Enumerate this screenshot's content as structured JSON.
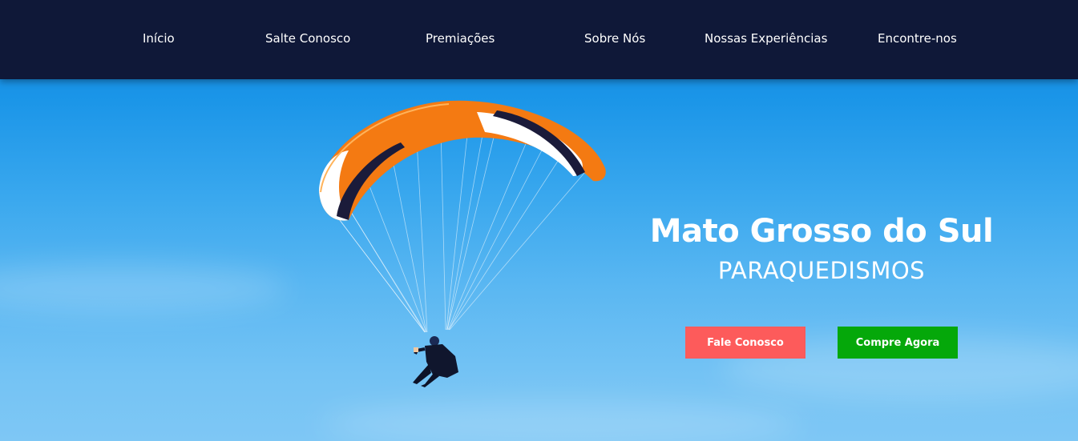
{
  "nav": {
    "items": [
      {
        "label": "Início"
      },
      {
        "label": "Salte Conosco"
      },
      {
        "label": "Premiações"
      },
      {
        "label": "Sobre Nós"
      },
      {
        "label": "Nossas Experiências"
      },
      {
        "label": "Encontre-nos"
      }
    ]
  },
  "hero": {
    "title": "Mato Grosso do Sul",
    "subtitle": "PARAQUEDISMOS",
    "image": "paraglider-orange-white-wing"
  },
  "buttons": {
    "contact_label": "Fale Conosco",
    "buy_label": "Compre Agora"
  },
  "colors": {
    "navbar": "#0f1838",
    "sky": "#2b9fec",
    "contact_button": "#fd5b5b",
    "buy_button": "#05a80a",
    "wing_orange": "#f47a12"
  }
}
